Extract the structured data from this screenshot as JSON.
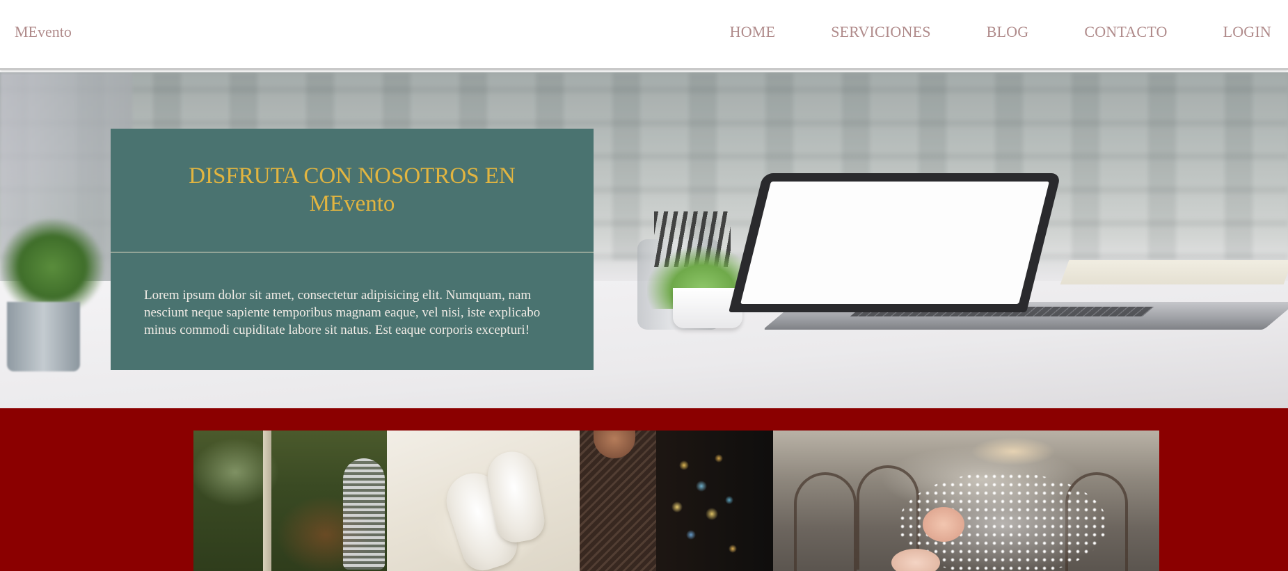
{
  "navbar": {
    "brand": "MEvento",
    "links": [
      "HOME",
      "SERVICIONES",
      "BLOG",
      "CONTACTO",
      "LOGIN"
    ]
  },
  "hero": {
    "title_line1": "DISFRUTA CON NOSOTROS EN",
    "title_line2": "MEvento",
    "text": "Lorem ipsum dolor sit amet, consectetur adipisicing elit. Numquam, nam nesciunt neque sapiente temporibus magnam eaque, vel nisi, iste explicabo minus commodi cupiditate labore sit natus. Est eaque corporis excepturi!"
  },
  "colors": {
    "nav_text": "#b08b8b",
    "hero_card_bg": "#4a7370",
    "hero_title": "#e2b540",
    "gallery_bg": "#8b0000"
  }
}
